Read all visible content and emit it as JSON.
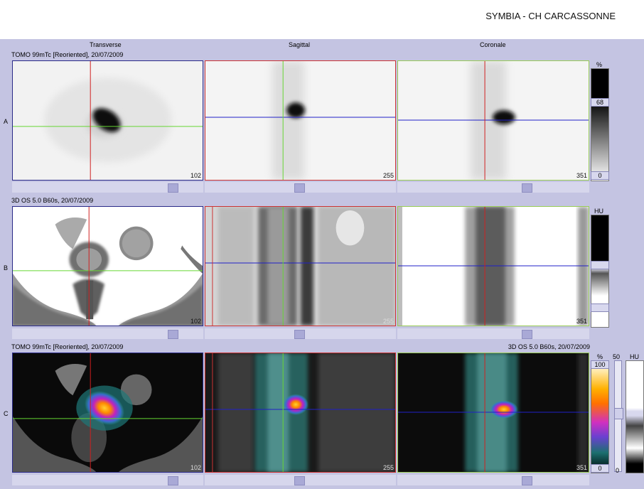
{
  "header": {
    "title": "SYMBIA - CH CARCASSONNE"
  },
  "views": {
    "transverse": "Transverse",
    "sagittal": "Sagittal",
    "coronal": "Coronale"
  },
  "rows": {
    "a": {
      "letter": "A",
      "series": "TOMO 99mTc [Reoriented], 20/07/2009",
      "slices": [
        "102",
        "255",
        "351"
      ],
      "unit": "%",
      "top_value": "68",
      "bottom_value": "0"
    },
    "b": {
      "letter": "B",
      "series": "3D  OS  5.0  B60s, 20/07/2009",
      "slices": [
        "102",
        "255",
        "351"
      ],
      "unit": "HU"
    },
    "c": {
      "letter": "C",
      "series_left": "TOMO 99mTc [Reoriented], 20/07/2009",
      "series_right": "3D  OS  5.0  B60s, 20/07/2009",
      "slices": [
        "102",
        "255",
        "351"
      ],
      "unit_pet": "%",
      "blend": "50",
      "unit_ct": "HU",
      "top_value": "100",
      "bottom_value": "0",
      "blend_bottom": "0"
    }
  },
  "colors": {
    "frame_green": "#99cc55",
    "frame_red": "#cc3333",
    "frame_blue": "#2a2a88",
    "crosshair_green": "#66d633",
    "crosshair_red": "#d02020",
    "crosshair_blue": "#2020c8"
  }
}
